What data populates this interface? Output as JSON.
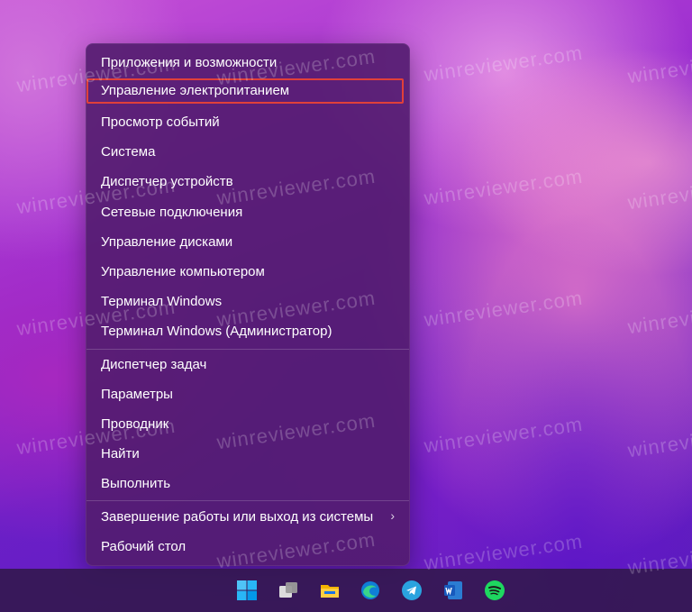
{
  "watermark_text": "winreviewer.com",
  "context_menu": {
    "group1": [
      "Приложения и возможности",
      "Управление электропитанием",
      "Просмотр событий",
      "Система",
      "Диспетчер устройств",
      "Сетевые подключения",
      "Управление дисками",
      "Управление компьютером",
      "Терминал Windows",
      "Терминал Windows (Администратор)"
    ],
    "group2": [
      "Диспетчер задач",
      "Параметры",
      "Проводник",
      "Найти",
      "Выполнить"
    ],
    "group3": [
      "Завершение работы или выход из системы",
      "Рабочий стол"
    ],
    "highlighted_item": "Управление электропитанием",
    "submenu_chevron": "›"
  },
  "taskbar": {
    "icons": [
      "windows-start-icon",
      "task-view-icon",
      "file-explorer-icon",
      "edge-icon",
      "telegram-icon",
      "word-icon",
      "spotify-icon"
    ]
  },
  "colors": {
    "highlight_border": "#e0403a",
    "menu_bg": "#521c6e"
  }
}
